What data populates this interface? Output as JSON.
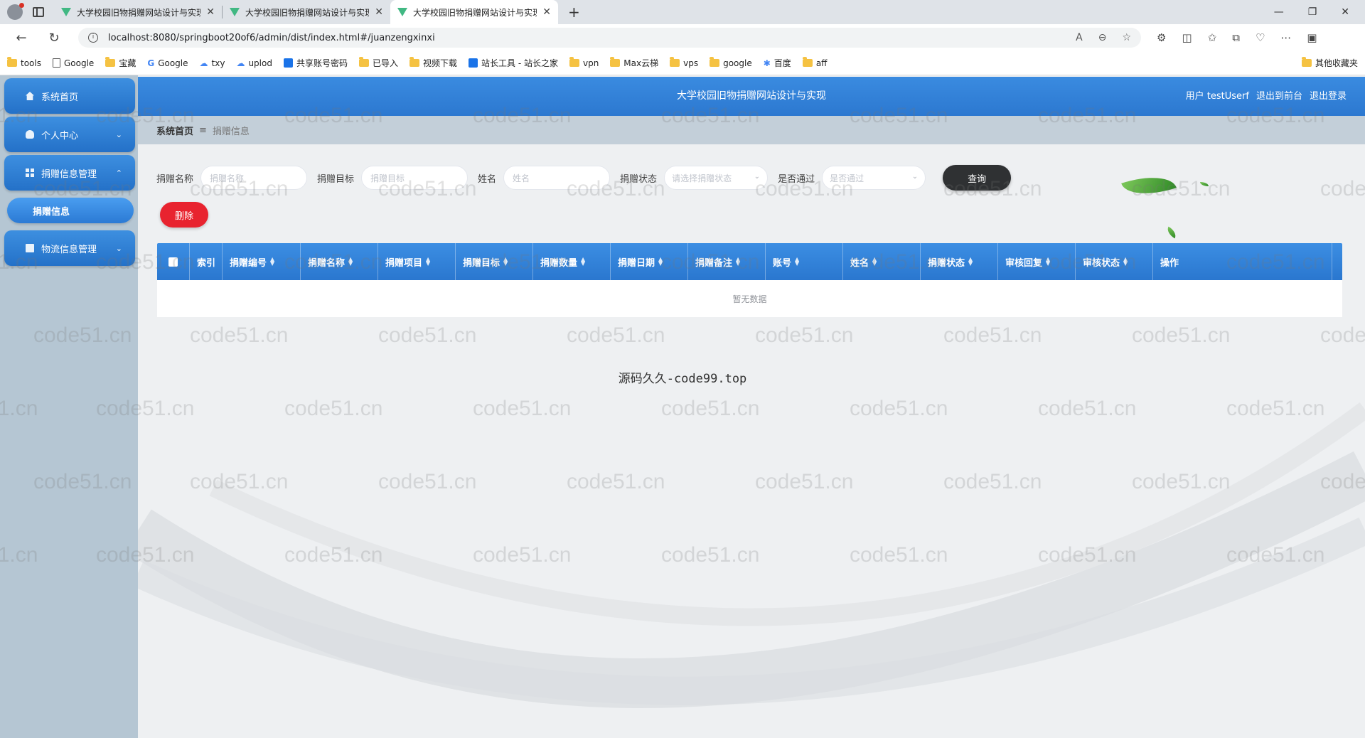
{
  "browser": {
    "tabs": [
      {
        "title": "大学校园旧物捐赠网站设计与实现",
        "active": false
      },
      {
        "title": "大学校园旧物捐赠网站设计与实现",
        "active": false
      },
      {
        "title": "大学校园旧物捐赠网站设计与实现",
        "active": true
      }
    ],
    "new_tab_glyph": "+",
    "window_controls": [
      "—",
      "❐",
      "✕"
    ],
    "url": "localhost:8080/springboot20of6/admin/dist/index.html#/juanzengxinxi",
    "bookmarks": [
      {
        "label": "tools",
        "icon": "folder-icon"
      },
      {
        "label": "Google",
        "icon": "page-icon"
      },
      {
        "label": "宝藏",
        "icon": "folder-icon"
      },
      {
        "label": "Google",
        "icon": "google-icon"
      },
      {
        "label": "txy",
        "icon": "cloud-icon"
      },
      {
        "label": "uplod",
        "icon": "cloud-icon"
      },
      {
        "label": "共享账号密码",
        "icon": "blue-icon"
      },
      {
        "label": "已导入",
        "icon": "folder-icon"
      },
      {
        "label": "视频下载",
        "icon": "folder-icon"
      },
      {
        "label": "站长工具 - 站长之家",
        "icon": "blue-icon"
      },
      {
        "label": "vpn",
        "icon": "folder-icon"
      },
      {
        "label": "Max云梯",
        "icon": "folder-icon"
      },
      {
        "label": "vps",
        "icon": "folder-icon"
      },
      {
        "label": "google",
        "icon": "folder-icon"
      },
      {
        "label": "百度",
        "icon": "baidu-icon"
      },
      {
        "label": "aff",
        "icon": "folder-icon"
      }
    ],
    "other_bookmarks": "其他收藏夹"
  },
  "header": {
    "title": "大学校园旧物捐赠网站设计与实现",
    "user_label": "用户 testUserf",
    "back_to_front": "退出到前台",
    "logout": "退出登录"
  },
  "sidebar": {
    "items": [
      {
        "label": "系统首页",
        "icon": "home-icon"
      },
      {
        "label": "个人中心",
        "icon": "user-icon",
        "arrow": "⌄"
      },
      {
        "label": "捐赠信息管理",
        "icon": "grid-icon",
        "arrow": "⌃"
      },
      {
        "label": "物流信息管理",
        "icon": "box-icon",
        "arrow": "⌄"
      }
    ],
    "sub_item": "捐赠信息"
  },
  "breadcrumb": {
    "home": "系统首页",
    "separator": "≡",
    "current": "捐赠信息"
  },
  "search": {
    "fields": [
      {
        "label": "捐赠名称",
        "placeholder": "捐赠名称"
      },
      {
        "label": "捐赠目标",
        "placeholder": "捐赠目标"
      },
      {
        "label": "姓名",
        "placeholder": "姓名"
      }
    ],
    "selects": [
      {
        "label": "捐赠状态",
        "placeholder": "请选择捐赠状态"
      },
      {
        "label": "是否通过",
        "placeholder": "是否通过"
      }
    ],
    "query_button": "查询"
  },
  "actions": {
    "delete_button": "删除"
  },
  "table": {
    "columns": [
      "索引",
      "捐赠编号",
      "捐赠名称",
      "捐赠项目",
      "捐赠目标",
      "捐赠数量",
      "捐赠日期",
      "捐赠备注",
      "账号",
      "姓名",
      "捐赠状态",
      "审核回复",
      "审核状态",
      "操作"
    ],
    "empty_text": "暂无数据"
  },
  "overlay_text": "源码久久-code99.top",
  "watermark": "code51.cn",
  "colors": {
    "primary": "#2c78d0",
    "danger": "#e8232f",
    "dark_button": "#2f3133",
    "sidebar_bg": "#b5c6d3"
  }
}
